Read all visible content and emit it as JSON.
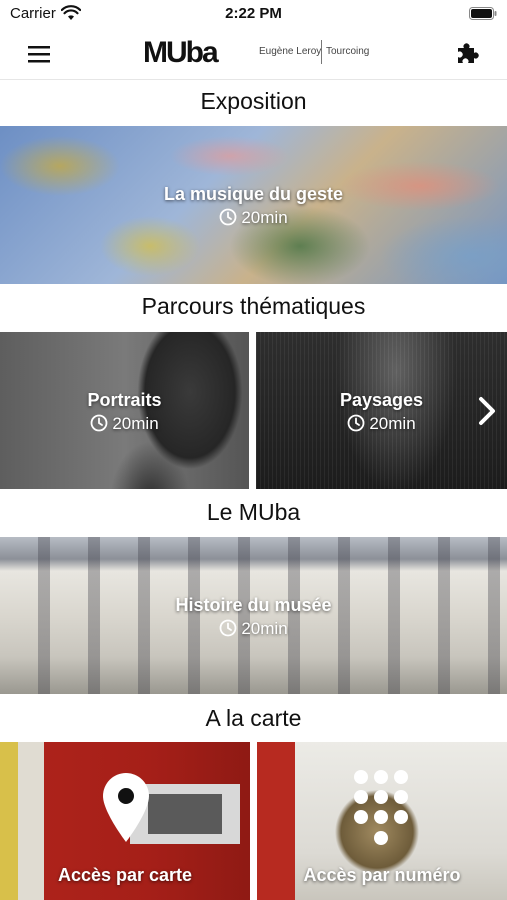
{
  "status_bar": {
    "carrier": "Carrier",
    "time": "2:22 PM"
  },
  "header": {
    "logo_main": "MUba",
    "logo_sub1": "Eugène Leroy",
    "logo_sub2": "Tourcoing",
    "icons": {
      "menu": "hamburger-menu-icon",
      "right": "puzzle-piece-icon"
    }
  },
  "sections": {
    "exposition": {
      "title": "Exposition",
      "card": {
        "label": "La musique du geste",
        "duration": "20min"
      }
    },
    "parcours": {
      "title": "Parcours thématiques",
      "cards": [
        {
          "label": "Portraits",
          "duration": "20min"
        },
        {
          "label": "Paysages",
          "duration": "20min"
        }
      ]
    },
    "muba": {
      "title": "Le MUba",
      "card": {
        "label": "Histoire du musée",
        "duration": "20min"
      }
    },
    "carte": {
      "title": "A la carte",
      "cards": [
        {
          "label": "Accès par carte",
          "icon": "map-pin-icon"
        },
        {
          "label": "Accès par numéro",
          "icon": "keypad-icon"
        }
      ]
    }
  }
}
